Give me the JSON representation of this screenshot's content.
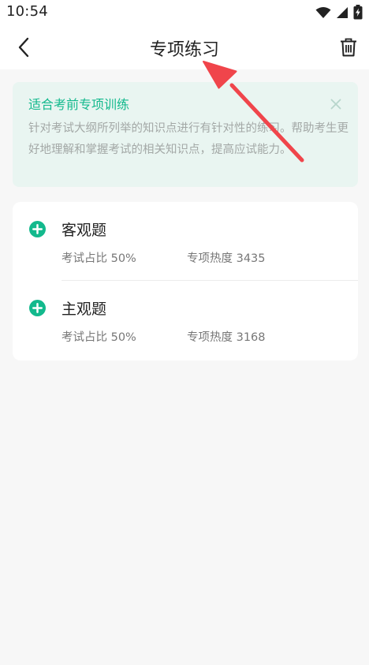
{
  "status_bar": {
    "time": "10:54",
    "icons": [
      "wifi-icon",
      "signal-icon",
      "battery-charging-icon"
    ]
  },
  "nav": {
    "title": "专项练习",
    "back_icon": "chevron-left-icon",
    "trash_icon": "trash-icon"
  },
  "banner": {
    "title": "适合考前专项训练",
    "text": "针对考试大纲所列举的知识点进行有针对性的练习。帮助考生更好地理解和掌握考试的相关知识点，提高应试能力。",
    "close_icon": "close-icon"
  },
  "items": [
    {
      "title": "客观题",
      "ratio": "考试占比 50%",
      "heat": "专项热度 3435"
    },
    {
      "title": "主观题",
      "ratio": "考试占比 50%",
      "heat": "专项热度 3168"
    }
  ],
  "colors": {
    "accent": "#13b98d",
    "banner_bg": "#e9f5f1",
    "arrow": "#f0454b"
  }
}
